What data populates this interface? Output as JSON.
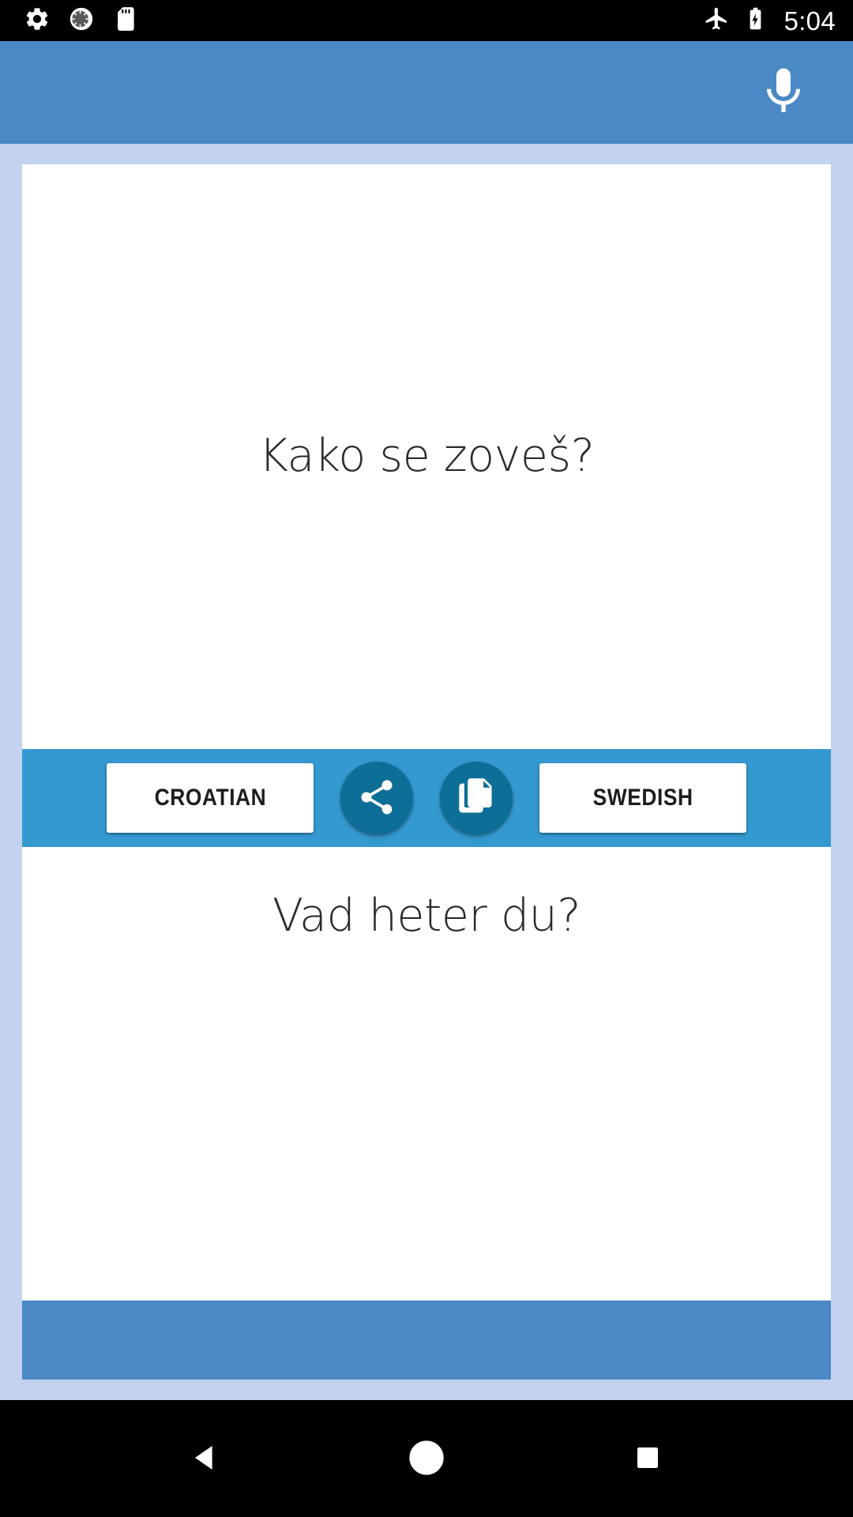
{
  "status_bar": {
    "icons_left": [
      "gear-icon",
      "brightness-dial-icon",
      "sd-card-icon"
    ],
    "icons_right": [
      "airplane-mode-icon",
      "battery-charging-icon"
    ],
    "clock": "5:04"
  },
  "app_bar": {
    "title": "",
    "mic_icon": "microphone-icon",
    "background_color": "#4a88c6"
  },
  "translation": {
    "source_text": "Kako se zoveš?",
    "target_text": "Vad heter du?"
  },
  "toolbar": {
    "source_language": "CROATIAN",
    "target_language": "SWEDISH",
    "share_icon": "share-icon",
    "copy_icon": "copy-icon",
    "background_color": "#3499d0",
    "fab_color": "#0d6f97"
  },
  "bottom_banner": {
    "label": "",
    "background_color": "#4a88c6"
  },
  "nav_bar": {
    "back": "back-triangle-icon",
    "home": "home-circle-icon",
    "recents": "recents-square-icon"
  }
}
